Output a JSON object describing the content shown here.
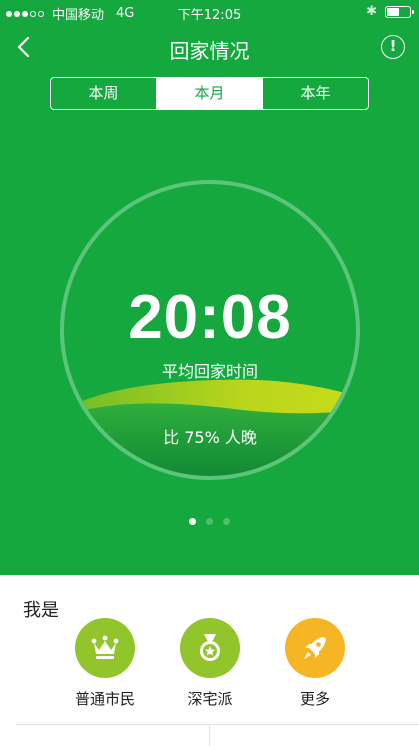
{
  "status_bar": {
    "carrier": "中国移动",
    "network": "4G",
    "time": "下午12:05",
    "signal_dots_filled": 3,
    "signal_dots_total": 5
  },
  "nav": {
    "title": "回家情况",
    "info_label": "!"
  },
  "segment": {
    "tabs": [
      {
        "label": "本周",
        "active": false
      },
      {
        "label": "本月",
        "active": true
      },
      {
        "label": "本年",
        "active": false
      }
    ]
  },
  "stats": {
    "avg_time": "20:08",
    "avg_label": "平均回家时间",
    "compare_text": "比 75% 人晚"
  },
  "pager": {
    "count": 3,
    "active_index": 0
  },
  "profile": {
    "heading": "我是",
    "badges": [
      {
        "label": "普通市民",
        "icon": "crown-icon",
        "color": "#92c52b"
      },
      {
        "label": "深宅派",
        "icon": "medal-icon",
        "color": "#92c52b"
      },
      {
        "label": "更多",
        "icon": "rocket-icon",
        "color": "#f5b524"
      }
    ]
  },
  "colors": {
    "primary_green": "#14a83f",
    "lime": "#92c52b",
    "orange": "#f5b524"
  }
}
